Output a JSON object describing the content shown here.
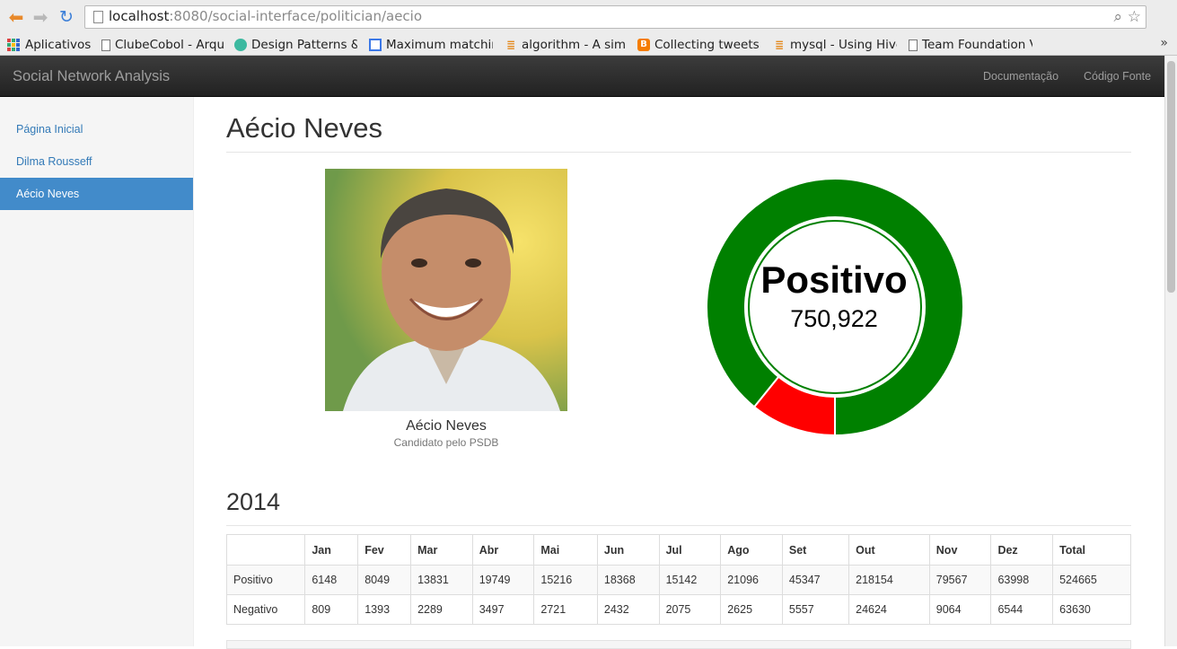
{
  "browser": {
    "url_host": "localhost",
    "url_rest": ":8080/social-interface/politician/aecio",
    "bookmarks": [
      {
        "label": "Aplicativos",
        "icon": "apps-icon"
      },
      {
        "label": "ClubeCobol - Arqui",
        "icon": "page-icon"
      },
      {
        "label": "Design Patterns &",
        "icon": "site-icon"
      },
      {
        "label": "Maximum matchin",
        "icon": "table-icon"
      },
      {
        "label": "algorithm - A simpl",
        "icon": "stackoverflow-icon"
      },
      {
        "label": "Collecting tweets",
        "icon": "blogger-icon"
      },
      {
        "label": "mysql - Using Hive",
        "icon": "stackoverflow-icon"
      },
      {
        "label": "Team Foundation V",
        "icon": "page-icon"
      }
    ],
    "more": "»"
  },
  "navbar": {
    "brand": "Social Network Analysis",
    "links": [
      "Documentação",
      "Código Fonte"
    ]
  },
  "sidebar": {
    "items": [
      {
        "label": "Página Inicial",
        "active": false
      },
      {
        "label": "Dilma Rousseff",
        "active": false
      },
      {
        "label": "Aécio Neves",
        "active": true
      }
    ]
  },
  "main": {
    "title": "Aécio Neves",
    "candidate": {
      "name": "Aécio Neves",
      "subtitle": "Candidato pelo PSDB"
    },
    "sentiment": {
      "label": "Positivo",
      "value": "750,922"
    },
    "year": "2014",
    "table": {
      "headers": [
        "",
        "Jan",
        "Fev",
        "Mar",
        "Abr",
        "Mai",
        "Jun",
        "Jul",
        "Ago",
        "Set",
        "Out",
        "Nov",
        "Dez",
        "Total"
      ],
      "rows": [
        [
          "Positivo",
          "6148",
          "8049",
          "13831",
          "19749",
          "15216",
          "18368",
          "15142",
          "21096",
          "45347",
          "218154",
          "79567",
          "63998",
          "524665"
        ],
        [
          "Negativo",
          "809",
          "1393",
          "2289",
          "3497",
          "2721",
          "2432",
          "2075",
          "2625",
          "5557",
          "24624",
          "9064",
          "6544",
          "63630"
        ]
      ]
    }
  },
  "chart_data": {
    "type": "pie",
    "categories": [
      "Positivo",
      "Negativo"
    ],
    "values": [
      524665,
      63630
    ],
    "colors": [
      "#008000",
      "#ff0000"
    ]
  }
}
